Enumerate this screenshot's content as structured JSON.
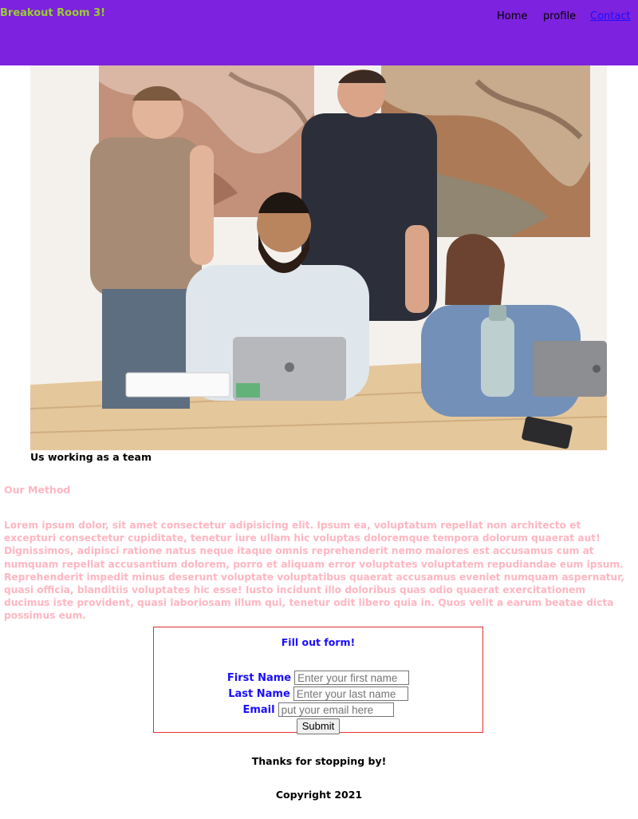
{
  "nav": {
    "brand": "Breakout Room 3!",
    "links": [
      "Home",
      "profile",
      "Contact"
    ]
  },
  "hero": {
    "caption": "Us working as a team"
  },
  "method": {
    "title": "Our Method",
    "body": "Lorem ipsum dolor, sit amet consectetur adipisicing elit. Ipsum ea, voluptatum repellat non architecto et excepturi consectetur cupiditate, tenetur iure ullam hic voluptas doloremque tempora dolorum quaerat aut! Dignissimos, adipisci ratione natus neque itaque omnis reprehenderit nemo maiores est accusamus cum at numquam repellat accusantium dolorem, porro et aliquam error voluptates voluptatem repudiandae eum ipsum. Reprehenderit impedit minus deserunt voluptate voluptatibus quaerat accusamus eveniet numquam aspernatur, quasi officia, blanditiis voluptates hic esse! Iusto incidunt illo doloribus quas odio quaerat exercitationem ducimus iste provident, quasi laboriosam illum qui, tenetur odit libero quia in. Quos velit a earum beatae dicta possimus eum."
  },
  "form": {
    "title": "Fill out form!",
    "first_name_label": "First Name",
    "first_name_placeholder": "Enter your first name",
    "last_name_label": "Last Name",
    "last_name_placeholder": "Enter your last name",
    "email_label": "Email",
    "email_placeholder": "put your email here",
    "submit_label": "Submit"
  },
  "footer": {
    "thanks": "Thanks for stopping by!",
    "copyright": "Copyright 2021"
  },
  "colors": {
    "navbar_bg": "#7d22de",
    "brand": "#9acd32",
    "link_active": "#1a0dff",
    "method_text": "#ffb6c1",
    "form_border": "#e0312c",
    "form_text": "#1a0dff"
  }
}
